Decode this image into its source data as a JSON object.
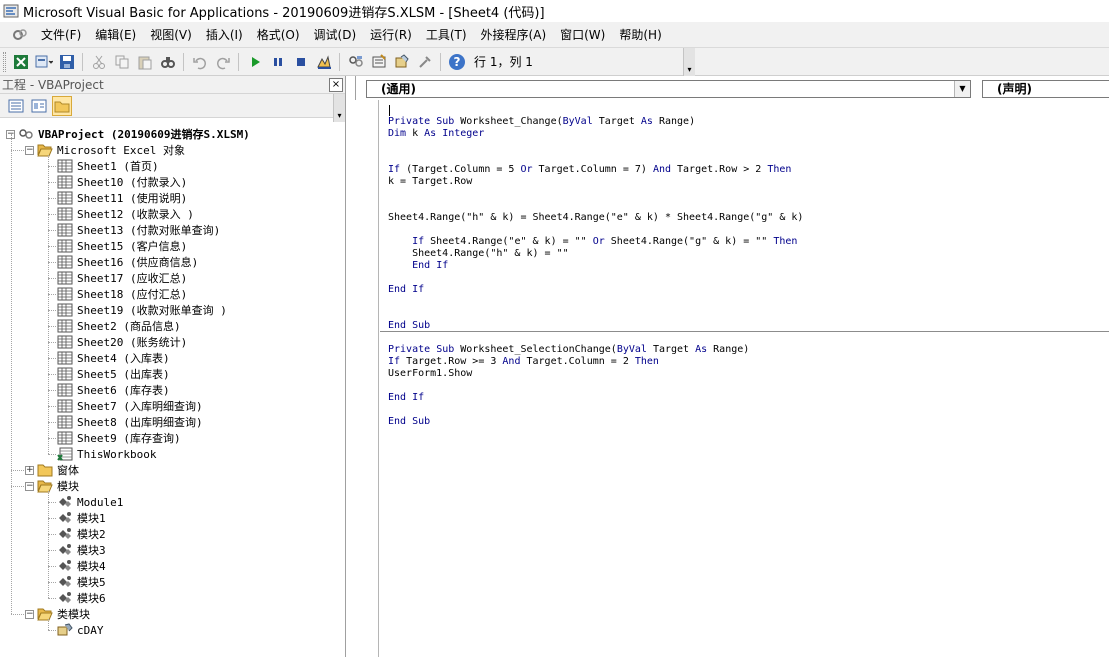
{
  "window": {
    "title": "Microsoft Visual Basic for Applications - 20190609进销存S.XLSM - [Sheet4 (代码)]"
  },
  "menubar": {
    "items": [
      "文件(F)",
      "编辑(E)",
      "视图(V)",
      "插入(I)",
      "格式(O)",
      "调试(D)",
      "运行(R)",
      "工具(T)",
      "外接程序(A)",
      "窗口(W)",
      "帮助(H)"
    ]
  },
  "toolbar": {
    "buttons": [
      "excel-view-icon",
      "insert-module-icon",
      "save-icon",
      "cut-icon",
      "copy-icon",
      "paste-icon",
      "find-icon",
      "undo-icon",
      "redo-icon",
      "run-icon",
      "break-icon",
      "reset-icon",
      "design-mode-icon",
      "project-explorer-icon",
      "properties-icon",
      "object-browser-icon",
      "toolbox-icon",
      "help-icon"
    ],
    "cursor_position": "行 1，列 1"
  },
  "project": {
    "title": "工程 - VBAProject",
    "close_label": "×",
    "tree": {
      "root": "VBAProject (20190609进销存S.XLSM)",
      "excel_objects_folder": "Microsoft Excel 对象",
      "sheets": [
        "Sheet1 (首页)",
        "Sheet10 (付款录入)",
        "Sheet11 (使用说明)",
        "Sheet12 (收款录入 )",
        "Sheet13 (付款对账单查询)",
        "Sheet15 (客户信息)",
        "Sheet16 (供应商信息)",
        "Sheet17 (应收汇总)",
        "Sheet18 (应付汇总)",
        "Sheet19 (收款对账单查询 )",
        "Sheet2 (商品信息)",
        "Sheet20 (账务统计)",
        "Sheet4 (入库表)",
        "Sheet5 (出库表)",
        "Sheet6 (库存表)",
        "Sheet7 (入库明细查询)",
        "Sheet8 (出库明细查询)",
        "Sheet9 (库存查询)",
        "ThisWorkbook"
      ],
      "forms_folder": "窗体",
      "modules_folder": "模块",
      "modules": [
        "Module1",
        "模块1",
        "模块2",
        "模块3",
        "模块4",
        "模块5",
        "模块6"
      ],
      "class_modules_folder": "类模块",
      "class_modules": [
        "cDAY"
      ]
    }
  },
  "code_window": {
    "object_combo": "(通用)",
    "procedure_combo": "(声明)",
    "lines_proc1": [
      "",
      "Private Sub Worksheet_Change(ByVal Target As Range)",
      "Dim k As Integer",
      "",
      "",
      "If (Target.Column = 5 Or Target.Column = 7) And Target.Row > 2 Then",
      "k = Target.Row",
      "",
      "",
      "Sheet4.Range(\"h\" & k) = Sheet4.Range(\"e\" & k) * Sheet4.Range(\"g\" & k)",
      "",
      "    If Sheet4.Range(\"e\" & k) = \"\" Or Sheet4.Range(\"g\" & k) = \"\" Then",
      "    Sheet4.Range(\"h\" & k) = \"\"",
      "    End If",
      "",
      "End If",
      "",
      "",
      "End Sub"
    ],
    "lines_proc2": [
      "Private Sub Worksheet_SelectionChange(ByVal Target As Range)",
      "If Target.Row >= 3 And Target.Column = 2 Then",
      "UserForm1.Show",
      "",
      "End If",
      "",
      "End Sub"
    ]
  }
}
